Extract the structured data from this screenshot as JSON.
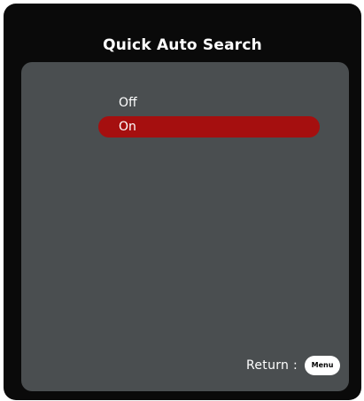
{
  "dialog": {
    "title": "Quick Auto Search"
  },
  "options": [
    {
      "label": "Off",
      "selected": false
    },
    {
      "label": "On",
      "selected": true
    }
  ],
  "footer": {
    "return_label": "Return :",
    "menu_button_label": "Menu"
  },
  "colors": {
    "frame": "#0a0a0a",
    "panel": "#4a4e50",
    "highlight": "#a50f0f",
    "text": "#ffffff"
  }
}
